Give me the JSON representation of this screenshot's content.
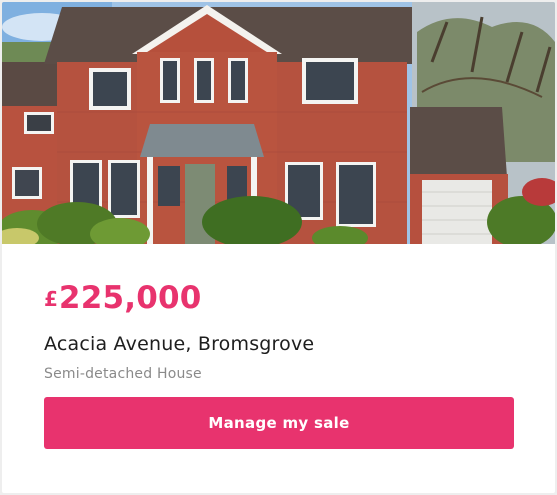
{
  "listing": {
    "currency_symbol": "£",
    "price": "225,000",
    "address": "Acacia Avenue, Bromsgrove",
    "property_type": "Semi-detached House",
    "photo_icon": "house-photo"
  },
  "actions": {
    "manage_label": "Manage my sale"
  },
  "colors": {
    "accent": "#e8336e",
    "text_primary": "#1e1e1e",
    "text_secondary": "#8a8a8a",
    "background": "#eeeeee",
    "card": "#ffffff"
  }
}
